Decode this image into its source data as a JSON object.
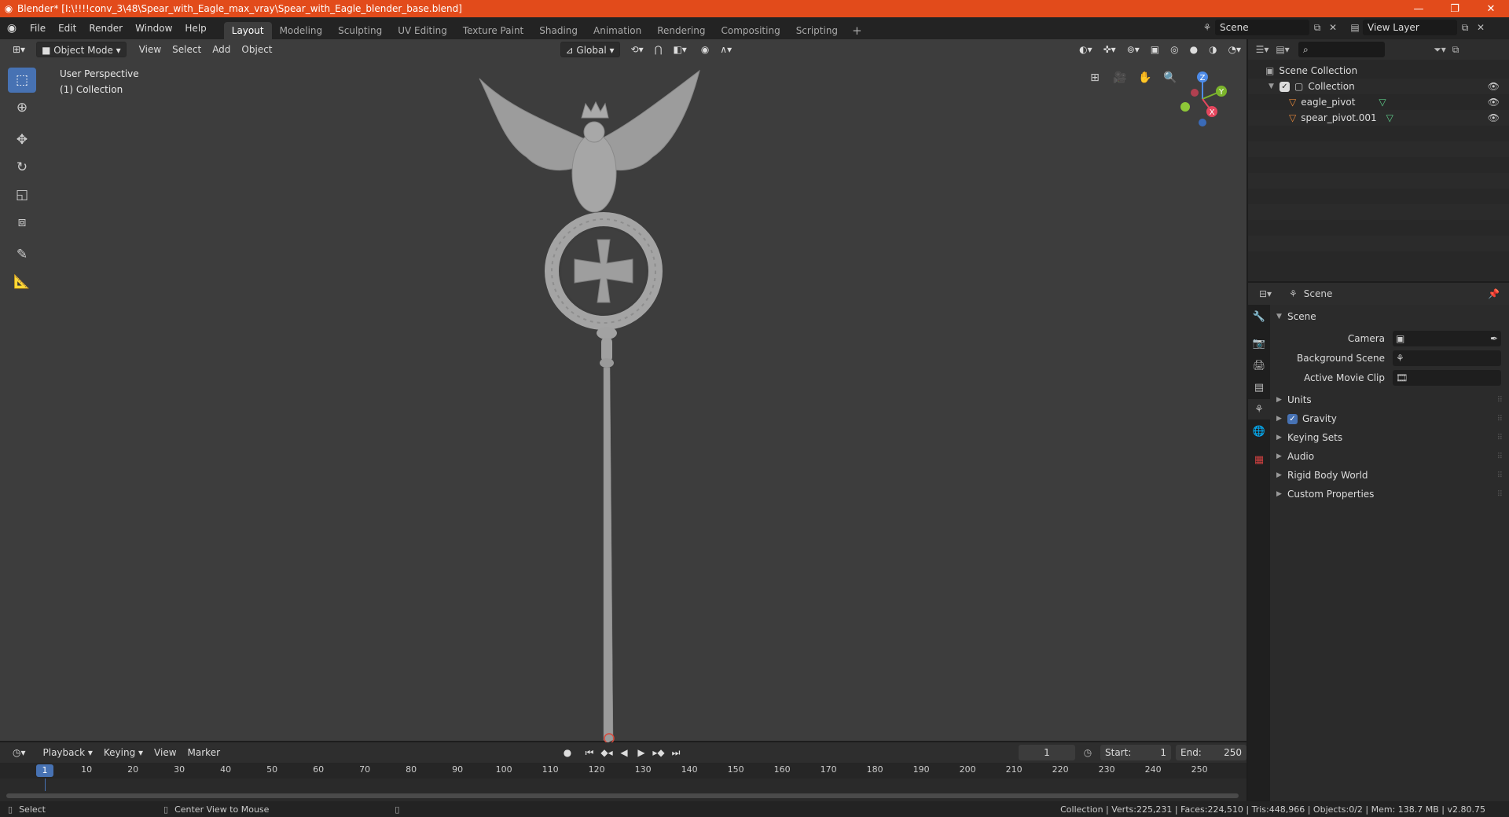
{
  "window": {
    "title": "Blender* [I:\\!!!!conv_3\\48\\Spear_with_Eagle_max_vray\\Spear_with_Eagle_blender_base.blend]",
    "controls": [
      "—",
      "❐",
      "✕"
    ]
  },
  "menu": [
    "File",
    "Edit",
    "Render",
    "Window",
    "Help"
  ],
  "workspaces": [
    "Layout",
    "Modeling",
    "Sculpting",
    "UV Editing",
    "Texture Paint",
    "Shading",
    "Animation",
    "Rendering",
    "Compositing",
    "Scripting"
  ],
  "active_workspace": "Layout",
  "scene_selector": {
    "scene": "Scene",
    "view_layer": "View Layer"
  },
  "viewport": {
    "mode": "Object Mode",
    "menus": [
      "View",
      "Select",
      "Add",
      "Object"
    ],
    "transform_orientation": "Global",
    "info_line1": "User Perspective",
    "info_line2": "(1) Collection",
    "gizmo_axes": [
      "Z",
      "Y",
      "X"
    ]
  },
  "outliner": {
    "root": "Scene Collection",
    "collection": "Collection",
    "objects": [
      "eagle_pivot",
      "spear_pivot.001"
    ]
  },
  "properties": {
    "header": "Scene",
    "panel": "Scene",
    "fields": [
      {
        "label": "Camera",
        "value": ""
      },
      {
        "label": "Background Scene",
        "value": ""
      },
      {
        "label": "Active Movie Clip",
        "value": ""
      }
    ],
    "subpanels": [
      "Units",
      "Gravity",
      "Keying Sets",
      "Audio",
      "Rigid Body World",
      "Custom Properties"
    ],
    "gravity_enabled": true
  },
  "timeline": {
    "menus": [
      "Playback",
      "Keying",
      "View",
      "Marker"
    ],
    "current_frame": "1",
    "start_label": "Start:",
    "start": "1",
    "end_label": "End:",
    "end": "250",
    "ticks": [
      "1",
      "10",
      "20",
      "30",
      "40",
      "50",
      "60",
      "70",
      "80",
      "90",
      "100",
      "110",
      "120",
      "130",
      "140",
      "150",
      "160",
      "170",
      "180",
      "190",
      "200",
      "210",
      "220",
      "230",
      "240",
      "250"
    ]
  },
  "statusbar": {
    "left": "Select",
    "middle": "Center View to Mouse",
    "right": "Collection | Verts:225,231 | Faces:224,510 | Tris:448,966 | Objects:0/2 | Mem: 138.7 MB | v2.80.75"
  },
  "colors": {
    "accent": "#4772b3",
    "titlebar": "#e24b1b",
    "object_orange": "#e8883a",
    "mesh_green": "#5ecf8a"
  }
}
